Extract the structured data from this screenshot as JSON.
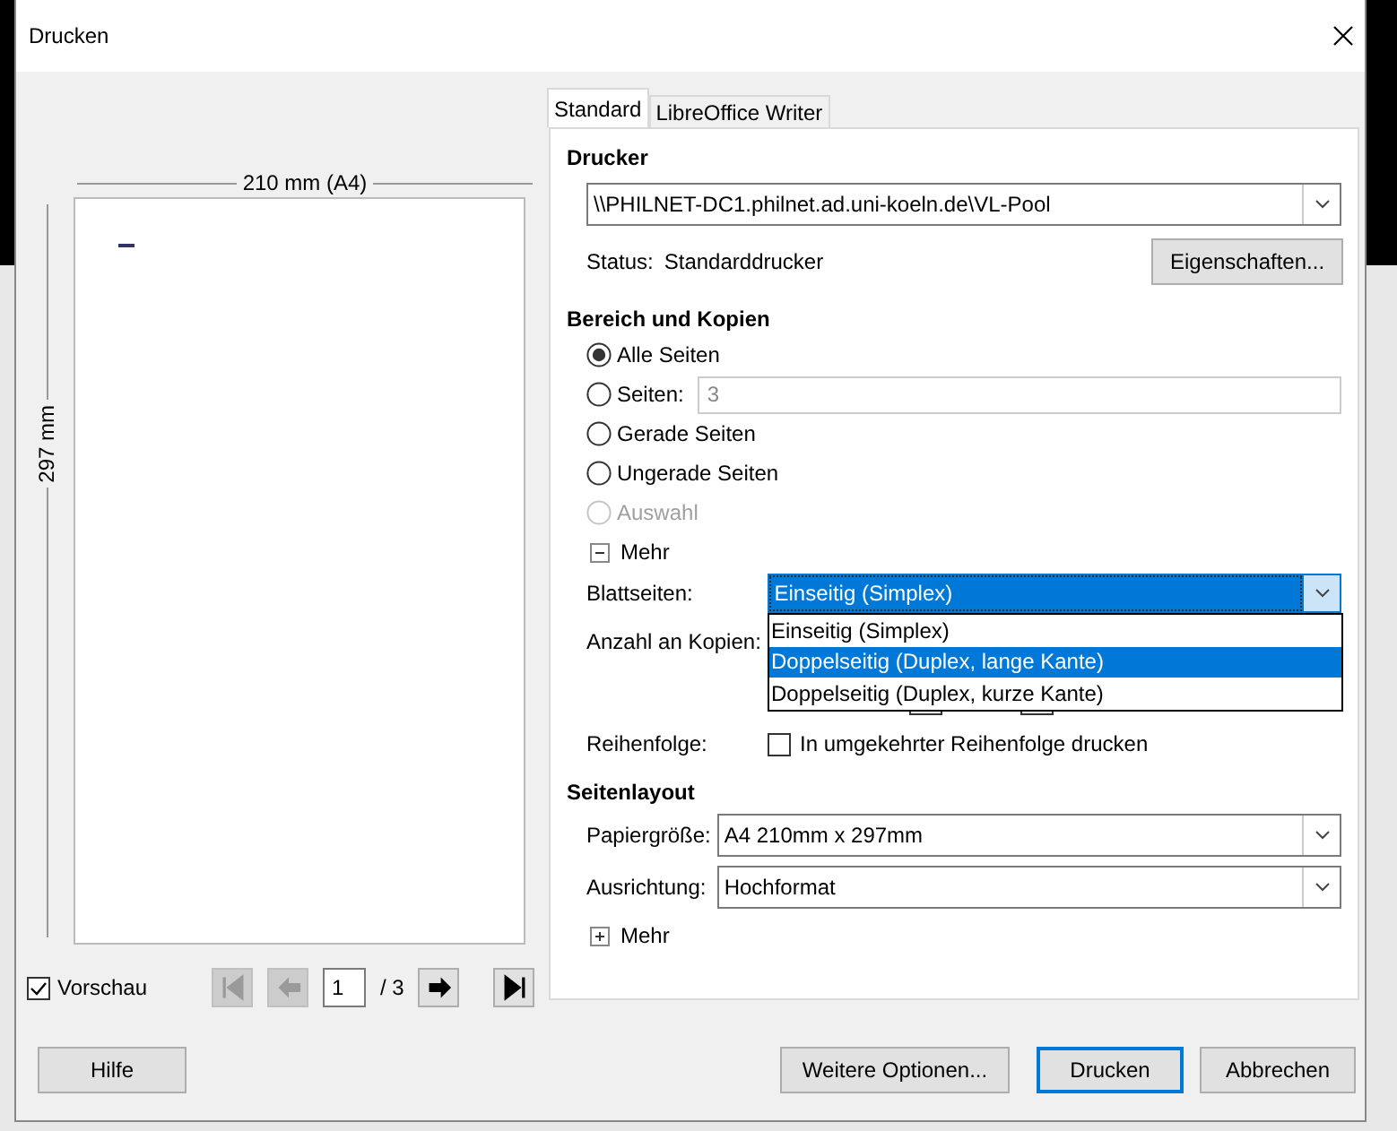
{
  "window": {
    "title": "Drucken"
  },
  "preview": {
    "width_label": "210 mm (A4)",
    "height_label": "297 mm",
    "show_preview": {
      "label": "Vorschau",
      "checked": true
    },
    "page": "1",
    "page_total": "/ 3",
    "nav": [
      {
        "kind": "first",
        "disabled": true
      },
      {
        "kind": "prev",
        "disabled": true
      },
      {
        "kind": "next",
        "disabled": false
      },
      {
        "kind": "last",
        "disabled": false
      }
    ]
  },
  "tabs": [
    {
      "label": "Standard",
      "selected": true
    },
    {
      "label": "LibreOffice Writer",
      "selected": false
    }
  ],
  "printer": {
    "heading": "Drucker",
    "name": "\\\\PHILNET-DC1.philnet.ad.uni-koeln.de\\VL-Pool",
    "status_label": "Status:",
    "status": "Standarddrucker",
    "properties_button": "Eigenschaften..."
  },
  "range": {
    "heading": "Bereich und Kopien",
    "options": [
      {
        "label": "Alle Seiten",
        "selected": true,
        "disabled": false
      },
      {
        "label": "Seiten:",
        "selected": false,
        "disabled": false,
        "field": {
          "value": "3",
          "disabled": true
        }
      },
      {
        "label": "Gerade Seiten",
        "selected": false,
        "disabled": false
      },
      {
        "label": "Ungerade Seiten",
        "selected": false,
        "disabled": false
      },
      {
        "label": "Auswahl",
        "selected": false,
        "disabled": true
      }
    ],
    "more": {
      "label": "Mehr",
      "expanded": true
    },
    "sides": {
      "label": "Blattseiten:",
      "value": "Einseitig (Simplex)",
      "open": true,
      "options": [
        {
          "label": "Einseitig (Simplex)",
          "highlighted": false
        },
        {
          "label": "Doppelseitig (Duplex, lange Kante)",
          "highlighted": true
        },
        {
          "label": "Doppelseitig (Duplex, kurze Kante)",
          "highlighted": false
        }
      ]
    },
    "copies_label": "Anzahl an Kopien:",
    "order": {
      "label": "Reihenfolge:",
      "checkbox": {
        "label": "In umgekehrter Reihenfolge drucken",
        "checked": false
      }
    }
  },
  "layout": {
    "heading": "Seitenlayout",
    "fields": [
      {
        "label": "Papiergröße:",
        "value": "A4 210mm x 297mm"
      },
      {
        "label": "Ausrichtung:",
        "value": "Hochformat"
      }
    ],
    "more": {
      "label": "Mehr",
      "expanded": false
    }
  },
  "buttons": [
    {
      "label": "Hilfe",
      "default": false
    },
    {
      "label": "Weitere Optionen...",
      "default": false
    },
    {
      "label": "Drucken",
      "default": true
    },
    {
      "label": "Abbrechen",
      "default": false
    }
  ]
}
